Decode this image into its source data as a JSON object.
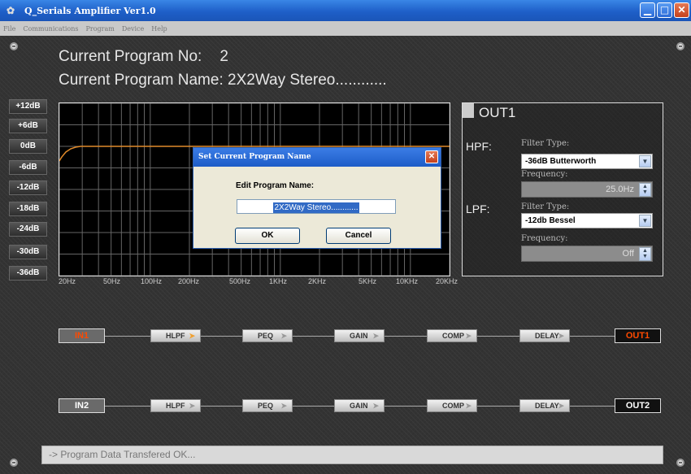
{
  "window": {
    "title": "Q_Serials Amplifier Ver1.0"
  },
  "menu": [
    "File",
    "Communications",
    "Program",
    "Device",
    "Help"
  ],
  "program": {
    "no_label": "Current Program No:",
    "no_value": "2",
    "name_label": "Current Program Name: 2X2Way Stereo............"
  },
  "db_buttons": [
    "+12dB",
    "+6dB",
    "0dB",
    "-6dB",
    "-12dB",
    "-18dB",
    "-24dB",
    "-30dB",
    "-36dB"
  ],
  "freq_labels": [
    "20Hz",
    "50Hz",
    "100Hz",
    "200Hz",
    "500Hz",
    "1KHz",
    "2KHz",
    "5KHz",
    "10KHz",
    "20KHz"
  ],
  "curve_color": "#e08a2a",
  "out_panel": {
    "title": "OUT1",
    "hpf": {
      "label": "HPF:",
      "filter_label": "Filter Type:",
      "filter_value": "-36dB Butterworth",
      "freq_label": "Frequency:",
      "freq_value": "25.0Hz"
    },
    "lpf": {
      "label": "LPF:",
      "filter_label": "Filter Type:",
      "filter_value": "-12db Bessel",
      "freq_label": "Frequency:",
      "freq_value": "Off"
    }
  },
  "chain1": {
    "input": "IN1",
    "output": "OUT1",
    "nodes": [
      "HLPF",
      "PEQ",
      "GAIN",
      "COMP",
      "DELAY"
    ]
  },
  "chain2": {
    "input": "IN2",
    "output": "OUT2",
    "nodes": [
      "HLPF",
      "PEQ",
      "GAIN",
      "COMP",
      "DELAY"
    ]
  },
  "dialog": {
    "title": "Set Current Program Name",
    "label": "Edit Program Name:",
    "value": "2X2Way Stereo............",
    "ok": "OK",
    "cancel": "Cancel"
  },
  "status": "-> Program Data Transfered OK..."
}
